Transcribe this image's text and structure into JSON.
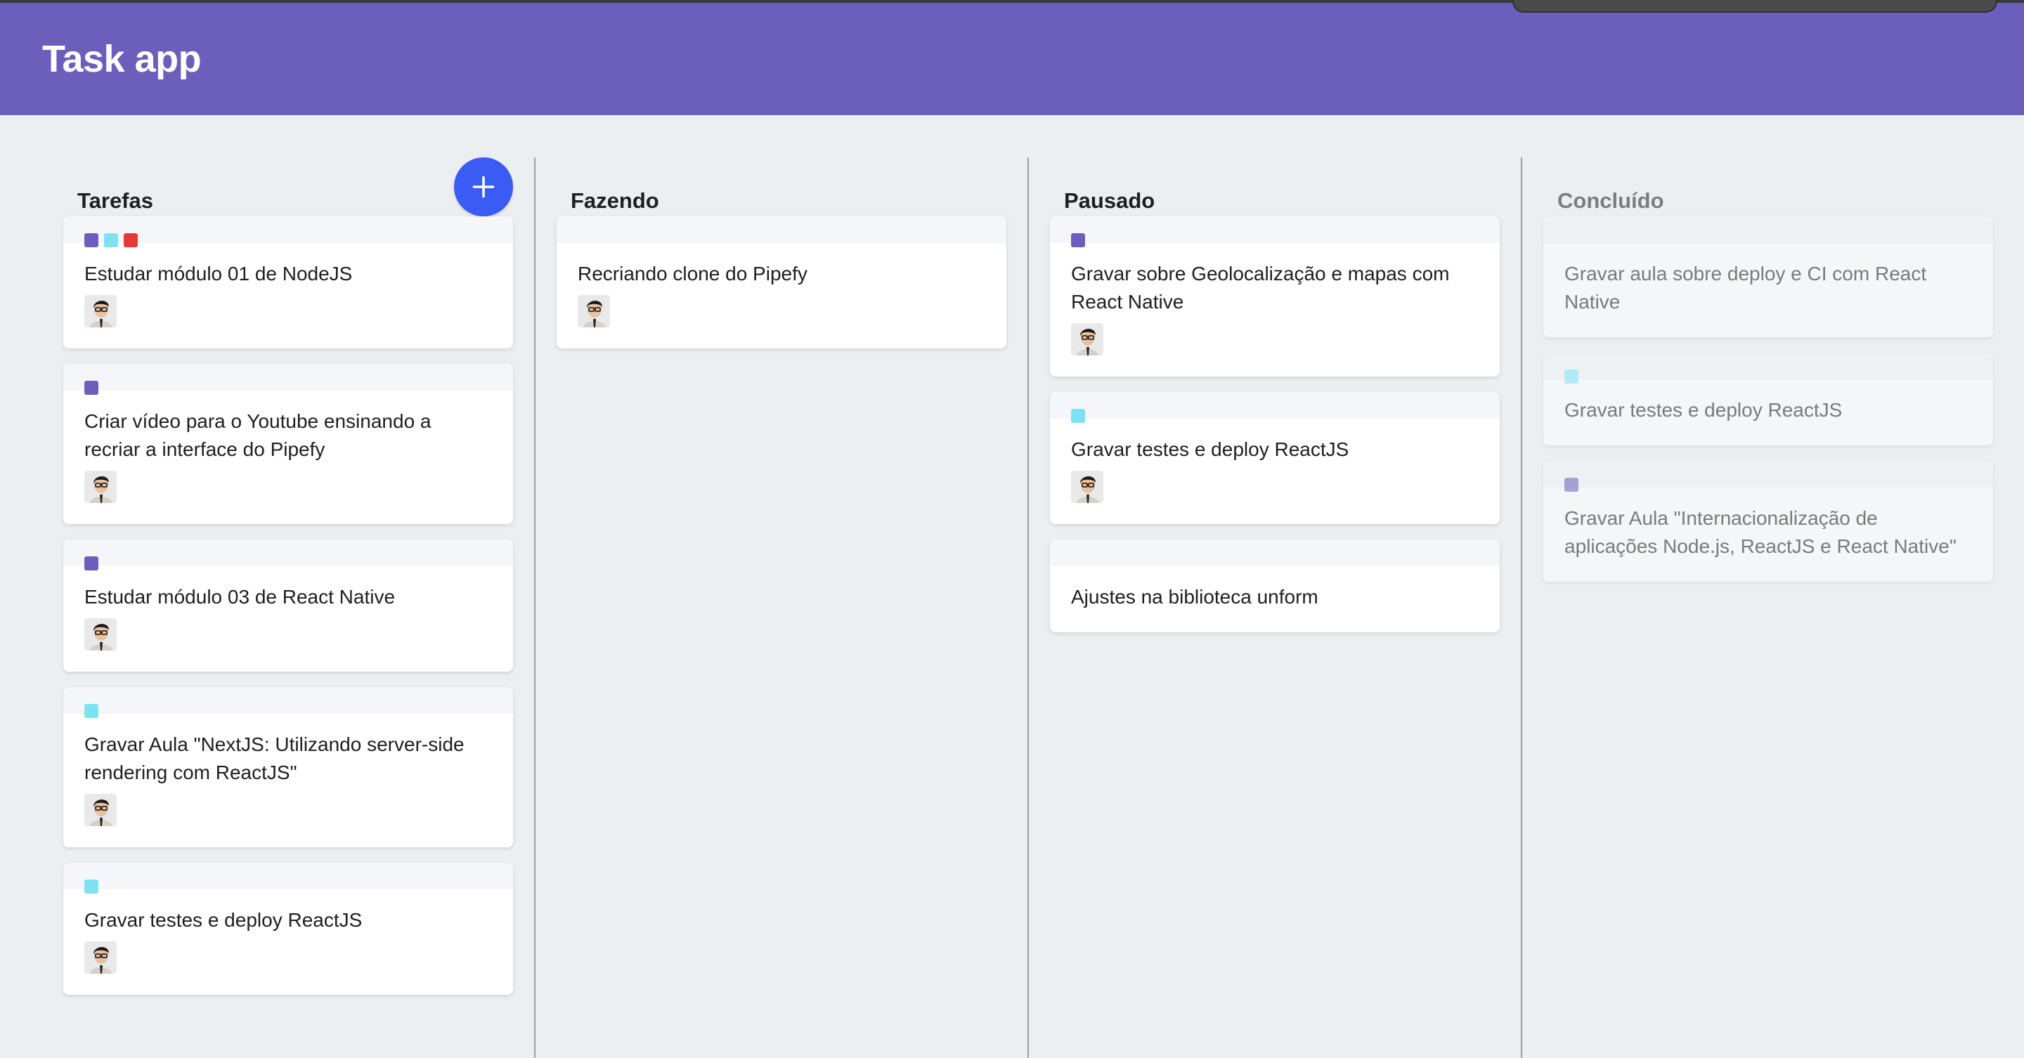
{
  "app": {
    "title": "Task app",
    "header_color": "#6c5fbc"
  },
  "label_colors": {
    "purple": "#6c5fbc",
    "cyan": "#7ee2f2",
    "red": "#e53935"
  },
  "add_button": {
    "icon": "plus-icon",
    "color": "#3b5bf5"
  },
  "columns": [
    {
      "title": "Tarefas",
      "cards": [
        {
          "title": "Estudar módulo 01 de NodeJS",
          "labels": [
            "purple",
            "cyan",
            "red"
          ],
          "has_avatar": true
        },
        {
          "title": "Criar vídeo para o Youtube ensinando a recriar a interface do Pipefy",
          "labels": [
            "purple"
          ],
          "has_avatar": true
        },
        {
          "title": "Estudar módulo 03 de React Native",
          "labels": [
            "purple"
          ],
          "has_avatar": true
        },
        {
          "title": "Gravar Aula \"NextJS: Utilizando server-side rendering com ReactJS\"",
          "labels": [
            "cyan"
          ],
          "has_avatar": true
        },
        {
          "title": "Gravar testes e deploy ReactJS",
          "labels": [
            "cyan"
          ],
          "has_avatar": true
        }
      ]
    },
    {
      "title": "Fazendo",
      "cards": [
        {
          "title": "Recriando clone do Pipefy",
          "labels": [],
          "has_avatar": true
        }
      ]
    },
    {
      "title": "Pausado",
      "cards": [
        {
          "title": "Gravar sobre Geolocalização e mapas com React Native",
          "labels": [
            "purple"
          ],
          "has_avatar": true
        },
        {
          "title": "Gravar testes e deploy ReactJS",
          "labels": [
            "cyan"
          ],
          "has_avatar": true
        },
        {
          "title": "Ajustes na biblioteca unform",
          "labels": [],
          "has_avatar": false
        }
      ]
    },
    {
      "title": "Concluído",
      "cards": [
        {
          "title": "Gravar aula sobre deploy e CI com React Native",
          "labels": [],
          "has_avatar": false
        },
        {
          "title": "Gravar testes e deploy ReactJS",
          "labels": [
            "cyan"
          ],
          "has_avatar": false
        },
        {
          "title": "Gravar Aula \"Internacionalização de aplicações Node.js, ReactJS e React Native\"",
          "labels": [
            "purple"
          ],
          "has_avatar": false
        }
      ]
    }
  ]
}
